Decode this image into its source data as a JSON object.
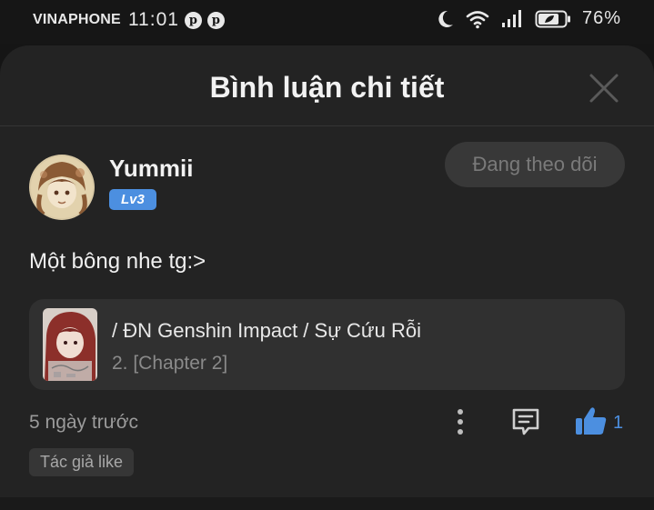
{
  "status_bar": {
    "carrier": "VINAPHONE",
    "time": "11:01",
    "battery": "76%",
    "icons": [
      "pinterest-icon",
      "pinterest-icon",
      "moon-icon",
      "wifi-icon",
      "signal-icon",
      "battery-icon"
    ]
  },
  "sheet": {
    "title": "Bình luận chi tiết",
    "close_icon": "close-icon"
  },
  "user": {
    "name": "Yummii",
    "level": "Lv3",
    "follow_label": "Đang theo dõi"
  },
  "comment": {
    "text": "Một bông nhe tg:>",
    "story_title": "/ ĐN Genshin Impact / Sự Cứu Rỗi",
    "chapter": "2. [Chapter 2]",
    "time_ago": "5 ngày trước",
    "like_count": "1",
    "author_tag": "Tác giả like"
  },
  "colors": {
    "accent": "#4c8fe0",
    "sheet_bg": "#232323",
    "card_bg": "#303030",
    "status_bg": "#161616"
  }
}
